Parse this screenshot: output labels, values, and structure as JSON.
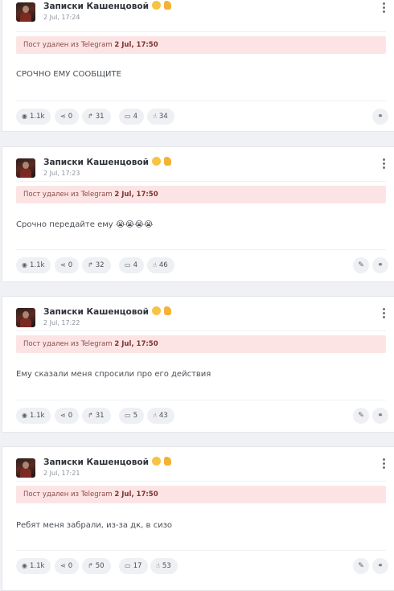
{
  "channel": {
    "name": "Записки Кашенцовой",
    "emoji": [
      "face-emoji",
      "thumbs-up-emoji"
    ]
  },
  "posts": [
    {
      "time": "2 Jul, 17:24",
      "deleted_prefix": "Пост удален из Telegram",
      "deleted_date": "2 Jul, 17:50",
      "text": "СРОЧНО ЕМУ СООБЩИТЕ",
      "stats": {
        "views": "1.1k",
        "shares": "0",
        "forwards": "31",
        "comments": "4",
        "reactions": "34"
      },
      "has_edit": false
    },
    {
      "time": "2 Jul, 17:23",
      "deleted_prefix": "Пост удален из Telegram",
      "deleted_date": "2 Jul, 17:50",
      "text": "Срочно передайте ему 😭😭😭😭",
      "stats": {
        "views": "1.1k",
        "shares": "0",
        "forwards": "32",
        "comments": "4",
        "reactions": "46"
      },
      "has_edit": true
    },
    {
      "time": "2 Jul, 17:22",
      "deleted_prefix": "Пост удален из Telegram",
      "deleted_date": "2 Jul, 17:50",
      "text": "Ему сказали меня спросили про его действия",
      "stats": {
        "views": "1.1k",
        "shares": "0",
        "forwards": "31",
        "comments": "5",
        "reactions": "43"
      },
      "has_edit": true
    },
    {
      "time": "2 Jul, 17:21",
      "deleted_prefix": "Пост удален из Telegram",
      "deleted_date": "2 Jul, 17:50",
      "text": "Ребят меня забрали, из-за дк, в сизо",
      "stats": {
        "views": "1.1k",
        "shares": "0",
        "forwards": "50",
        "comments": "17",
        "reactions": "53"
      },
      "has_edit": true
    }
  ],
  "icons": {
    "views": "eye-icon",
    "shares": "share-icon",
    "forwards": "forward-icon",
    "comments": "comments-icon",
    "reactions": "thumbs-up-icon",
    "edit": "pencil-icon",
    "link": "link-icon",
    "menu": "more-vertical-icon"
  }
}
